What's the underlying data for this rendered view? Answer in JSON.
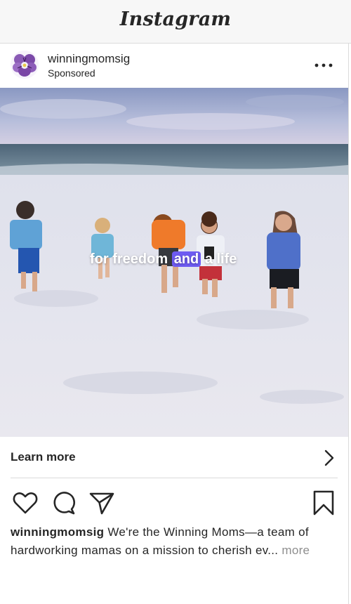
{
  "app": {
    "logo": "Instagram"
  },
  "post": {
    "username": "winningmomsig",
    "label": "Sponsored",
    "video_caption": {
      "before": "for freedom",
      "highlight": "and",
      "after": "a life"
    },
    "cta_label": "Learn more",
    "caption_user": "winningmomsig",
    "caption_text": "We're the Winning Moms—a team of hardworking mamas on a mission to cherish ev...",
    "more_label": "more"
  },
  "icons": {
    "options": "more-options-icon",
    "cta": "chevron-right-icon",
    "like": "heart-icon",
    "comment": "comment-icon",
    "share": "send-icon",
    "save": "bookmark-icon"
  },
  "colors": {
    "caption_highlight": "#6e5bf2",
    "text": "#262626",
    "muted": "#8e8e8e"
  }
}
